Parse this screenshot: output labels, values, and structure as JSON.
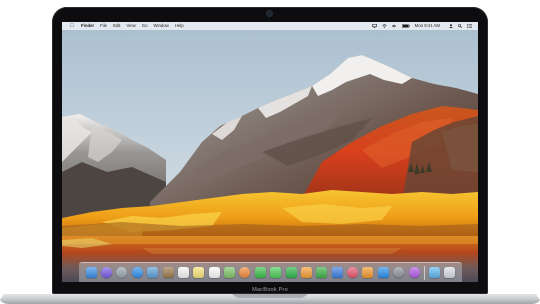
{
  "device": {
    "model_label": "MacBook Pro"
  },
  "menu_bar": {
    "apple_icon": "apple-logo-icon",
    "app_name": "Finder",
    "items": [
      "File",
      "Edit",
      "View",
      "Go",
      "Window",
      "Help"
    ],
    "status_icons": [
      "airplay-icon",
      "wifi-icon",
      "volume-icon",
      "battery-icon",
      "user-icon",
      "search-icon",
      "notification-center-icon"
    ],
    "clock": "Mon 9:41 AM"
  },
  "wallpaper": {
    "name": "macOS High Sierra mountain lake",
    "sky_color": "#b9cad8",
    "mountain_color": "#5b4f4b",
    "foliage_color": "#f0a818",
    "water_color": "#c0551b"
  },
  "dock": {
    "apps": [
      {
        "name": "finder-icon",
        "color": "#3a8ee6"
      },
      {
        "name": "siri-icon",
        "color": "#7a5ce6"
      },
      {
        "name": "launchpad-icon",
        "color": "#9aa3ad"
      },
      {
        "name": "safari-icon",
        "color": "#2f8fea"
      },
      {
        "name": "photos-viewer-icon",
        "color": "#5ea0d8"
      },
      {
        "name": "notes-brown-icon",
        "color": "#9b7a4a"
      },
      {
        "name": "calendar-icon",
        "color": "#f4f4f4"
      },
      {
        "name": "notes-icon",
        "color": "#f5e37a"
      },
      {
        "name": "reminders-icon",
        "color": "#fafafa"
      },
      {
        "name": "maps-icon",
        "color": "#7fc46a"
      },
      {
        "name": "photos-icon",
        "color": "#f28b3a"
      },
      {
        "name": "facetime-icon",
        "color": "#3bbf4a"
      },
      {
        "name": "messages-icon",
        "color": "#4ccd59"
      },
      {
        "name": "facetime-video-icon",
        "color": "#2fb64a"
      },
      {
        "name": "pages-icon",
        "color": "#f29d36"
      },
      {
        "name": "numbers-icon",
        "color": "#3fb14b"
      },
      {
        "name": "keynote-icon",
        "color": "#3d7fe0"
      },
      {
        "name": "itunes-icon",
        "color": "#e8576f"
      },
      {
        "name": "ibooks-icon",
        "color": "#f29a2e"
      },
      {
        "name": "app-store-icon",
        "color": "#2b8fea"
      },
      {
        "name": "system-preferences-icon",
        "color": "#8d949c"
      },
      {
        "name": "itunes-purple-icon",
        "color": "#b15be6"
      },
      {
        "name": "downloads-folder-icon",
        "color": "#5fb6ee"
      },
      {
        "name": "trash-icon",
        "color": "#d7dbe0"
      }
    ]
  }
}
